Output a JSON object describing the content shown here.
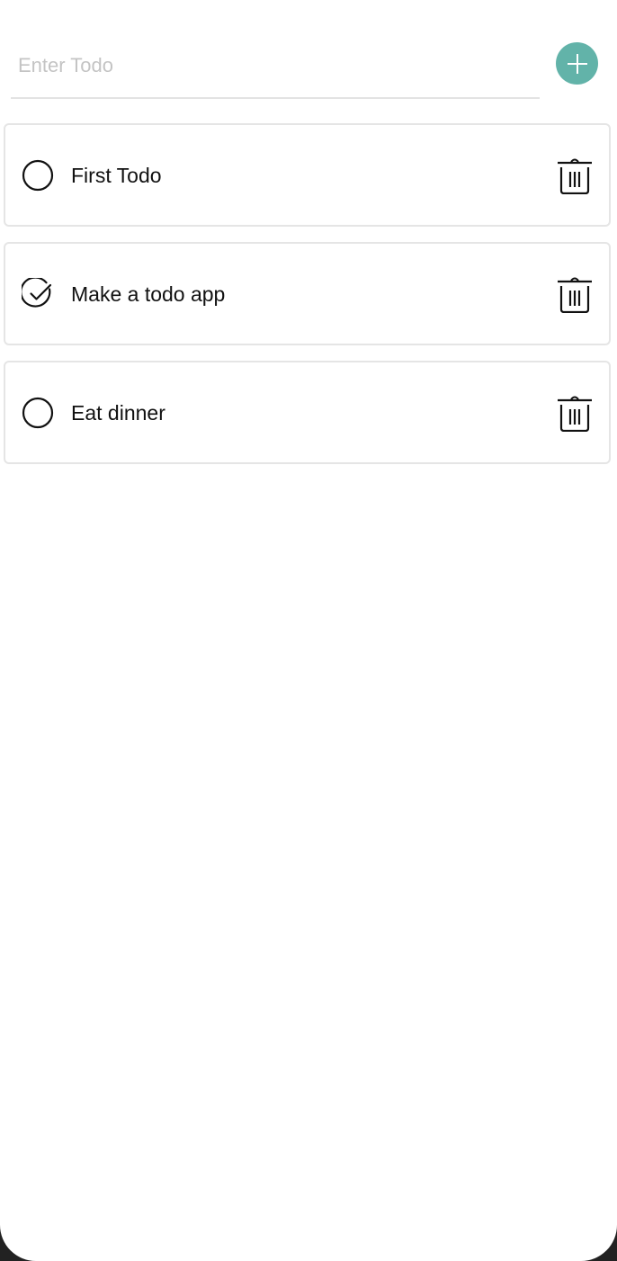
{
  "input": {
    "placeholder": "Enter Todo",
    "value": ""
  },
  "add_button": {
    "icon": "plus-icon",
    "color": "#62b3a9"
  },
  "todos": [
    {
      "label": "First Todo",
      "completed": false
    },
    {
      "label": "Make a todo app",
      "completed": true
    },
    {
      "label": "Eat dinner",
      "completed": false
    }
  ],
  "icons": {
    "incomplete": "circle-icon",
    "complete": "check-circle-icon",
    "delete": "trash-icon"
  }
}
